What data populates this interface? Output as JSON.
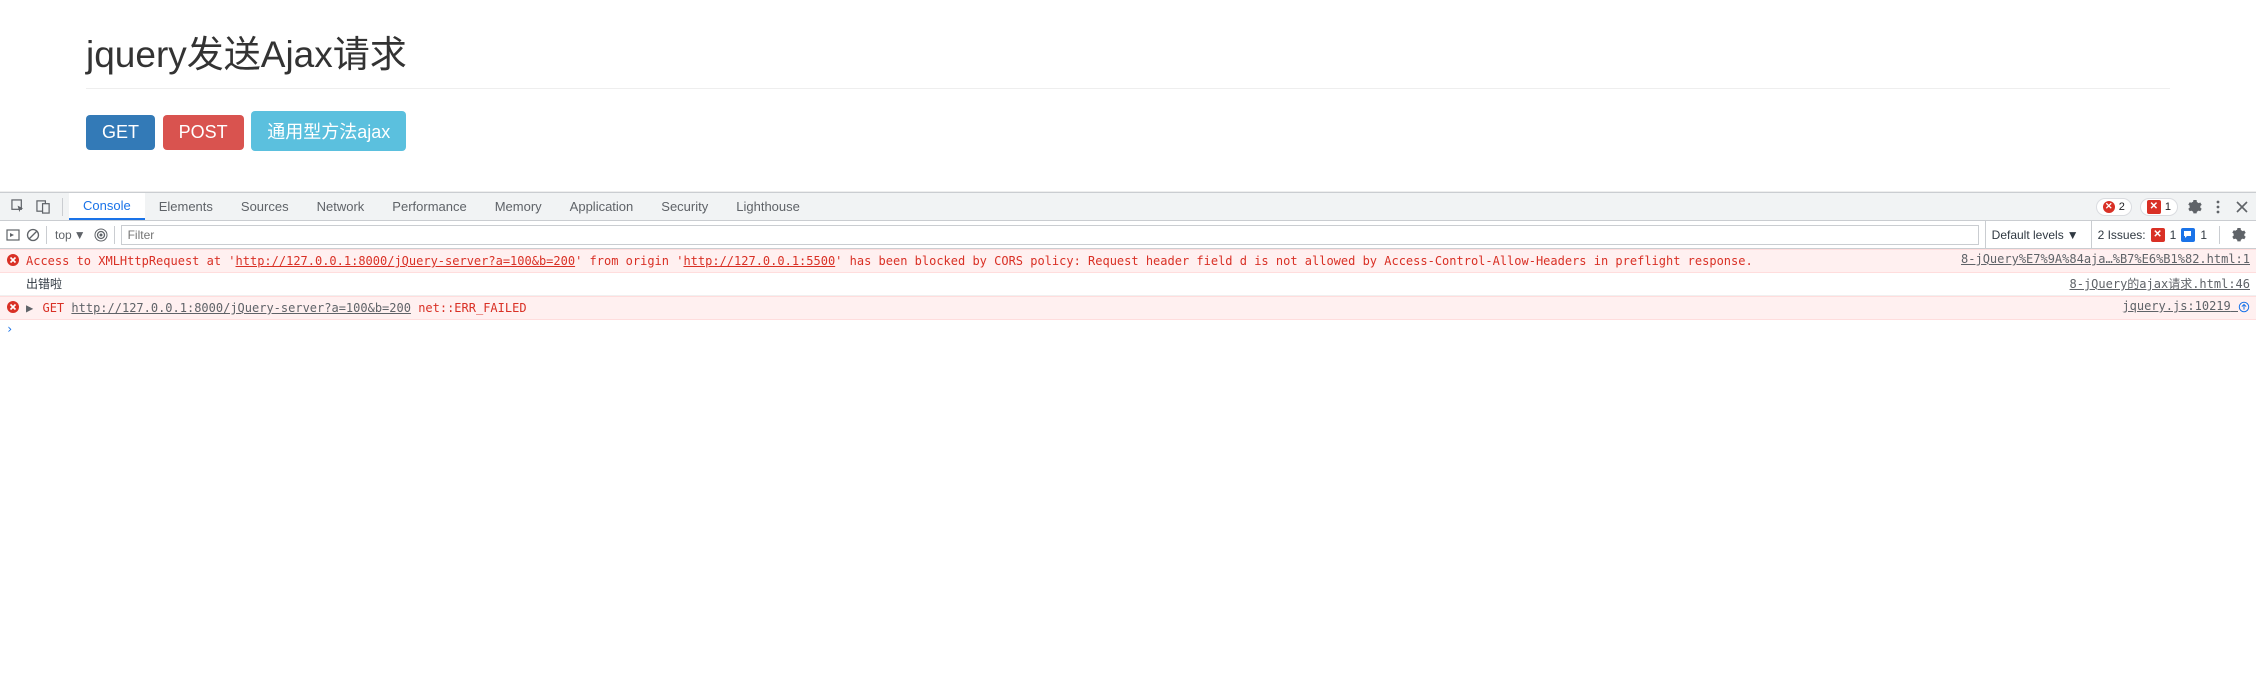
{
  "page": {
    "title": "jquery发送Ajax请求",
    "buttons": {
      "get": "GET",
      "post": "POST",
      "ajax": "通用型方法ajax"
    }
  },
  "devtools": {
    "tabs": [
      "Console",
      "Elements",
      "Sources",
      "Network",
      "Performance",
      "Memory",
      "Application",
      "Security",
      "Lighthouse"
    ],
    "active_tab": "Console",
    "error_count": "2",
    "issue_count": "1",
    "filterbar": {
      "context": "top",
      "filter_placeholder": "Filter",
      "levels": "Default levels",
      "issues_label": "2 Issues:",
      "issues_err": "1",
      "issues_info": "1"
    },
    "logs": {
      "cors": {
        "prefix": "Access to XMLHttpRequest at '",
        "url1": "http://127.0.0.1:8000/jQuery-server?a=100&b=200",
        "mid1": "' from origin '",
        "url2": "http://127.0.0.1:5500",
        "mid2": "' has been blocked by CORS policy: Request header field d is not allowed by Access-Control-Allow-Headers in preflight response.",
        "source": "8-jQuery%E7%9A%84aja…%B7%E6%B1%82.html:1"
      },
      "user": {
        "text": "出错啦",
        "source": "8-jQuery的ajax请求.html:46"
      },
      "net": {
        "method": "GET",
        "url": "http://127.0.0.1:8000/jQuery-server?a=100&b=200",
        "status": "net::ERR_FAILED",
        "source": "jquery.js:10219"
      }
    }
  }
}
